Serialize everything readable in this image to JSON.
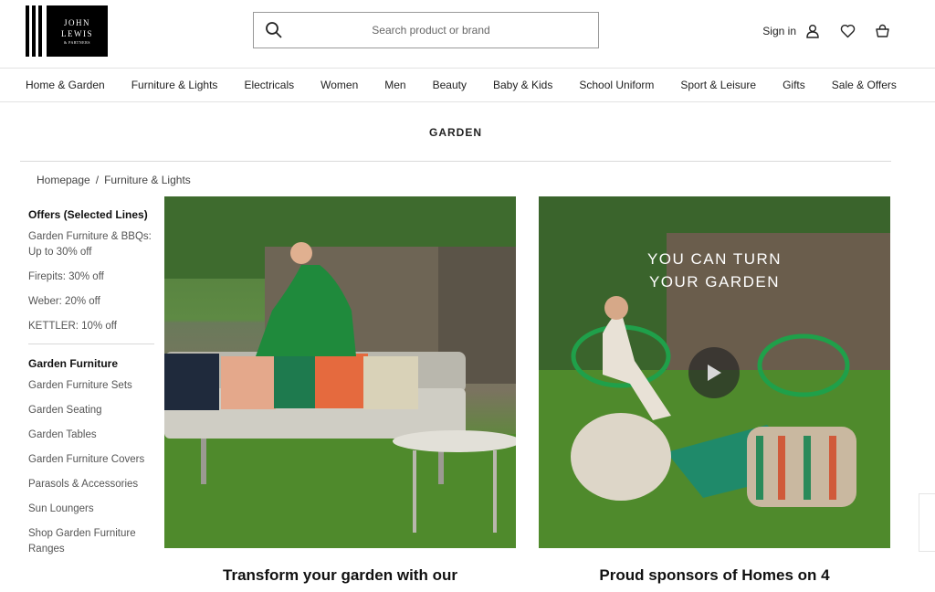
{
  "brand": {
    "logo_line1": "JOHN",
    "logo_line2": "LEWIS",
    "logo_line3": "& PARTNERS"
  },
  "header": {
    "search_placeholder": "Search product or brand",
    "sign_in_label": "Sign in"
  },
  "nav": {
    "items": [
      "Home & Garden",
      "Furniture & Lights",
      "Electricals",
      "Women",
      "Men",
      "Beauty",
      "Baby & Kids",
      "School Uniform",
      "Sport & Leisure",
      "Gifts",
      "Sale & Offers"
    ]
  },
  "page": {
    "title": "GARDEN"
  },
  "breadcrumb": {
    "items": [
      "Homepage",
      "Furniture & Lights"
    ],
    "separator": "/"
  },
  "sidebar": {
    "offers": {
      "heading": "Offers (Selected Lines)",
      "links": [
        "Garden Furniture & BBQs: Up to 30% off",
        "Firepits: 30% off",
        "Weber: 20% off",
        "KETTLER: 10% off"
      ]
    },
    "furniture": {
      "heading": "Garden Furniture",
      "links": [
        "Garden Furniture Sets",
        "Garden Seating",
        "Garden Tables",
        "Garden Furniture Covers",
        "Parasols & Accessories",
        "Sun Loungers",
        "Shop Garden Furniture Ranges"
      ]
    }
  },
  "promos": [
    {
      "title": "Transform your garden with our",
      "overlay": ""
    },
    {
      "title": "Proud sponsors of Homes on 4",
      "overlay_line1": "YOU CAN TURN",
      "overlay_line2": "YOUR GARDEN"
    }
  ],
  "colors": {
    "text": "#222222",
    "muted": "#555555",
    "rule": "#e2e2e2",
    "logo": "#000000"
  }
}
